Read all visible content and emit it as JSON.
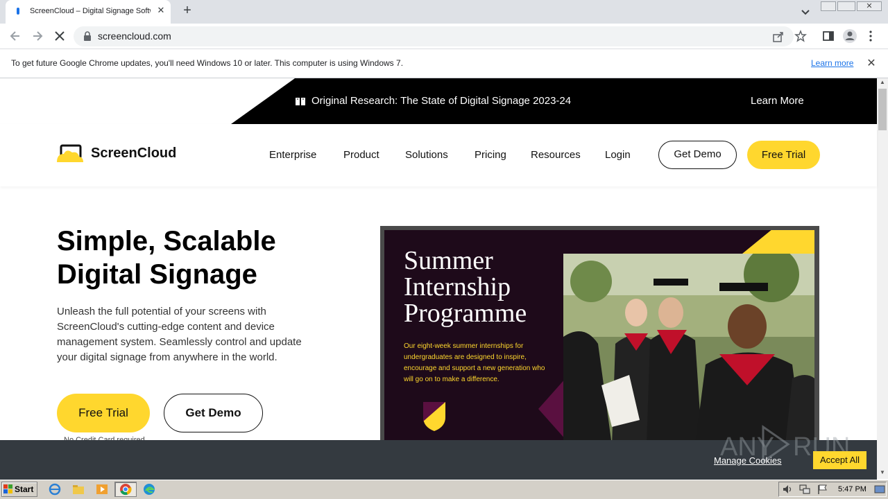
{
  "browser": {
    "tab_title": "ScreenCloud – Digital Signage Softw",
    "tab_close": "✕",
    "new_tab": "+",
    "url": "screencloud.com",
    "win_close": "✕"
  },
  "infobar": {
    "text": "To get future Google Chrome updates, you'll need Windows 10 or later. This computer is using Windows 7.",
    "link": "Learn more",
    "close": "✕"
  },
  "announcement": {
    "text": "Original Research: The State of Digital Signage 2023-24",
    "cta": "Learn More"
  },
  "header": {
    "logo_text": "ScreenCloud",
    "nav": [
      "Enterprise",
      "Product",
      "Solutions",
      "Pricing",
      "Resources",
      "Login"
    ],
    "demo_button": "Get Demo",
    "trial_button": "Free Trial"
  },
  "hero": {
    "title": "Simple, Scalable Digital Signage",
    "description": "Unleash the full potential of your screens with ScreenCloud's cutting-edge content and device management system. Seamlessly control and update your digital signage from anywhere in the world.",
    "trial_button": "Free Trial",
    "demo_button": "Get Demo",
    "note": "No Credit Card required"
  },
  "slide": {
    "title": "Summer Internship Programme",
    "text": "Our eight-week summer internships for undergraduates are designed to inspire, encourage and support a new generation who will go on to make a difference."
  },
  "cookies": {
    "manage": "Manage Cookies",
    "accept": "Accept All"
  },
  "taskbar": {
    "start": "Start",
    "clock": "5:47 PM"
  },
  "colors": {
    "brand_yellow": "#ffd72e",
    "cookie_bar": "#343a40",
    "slide_bg": "#1e0a1a"
  }
}
